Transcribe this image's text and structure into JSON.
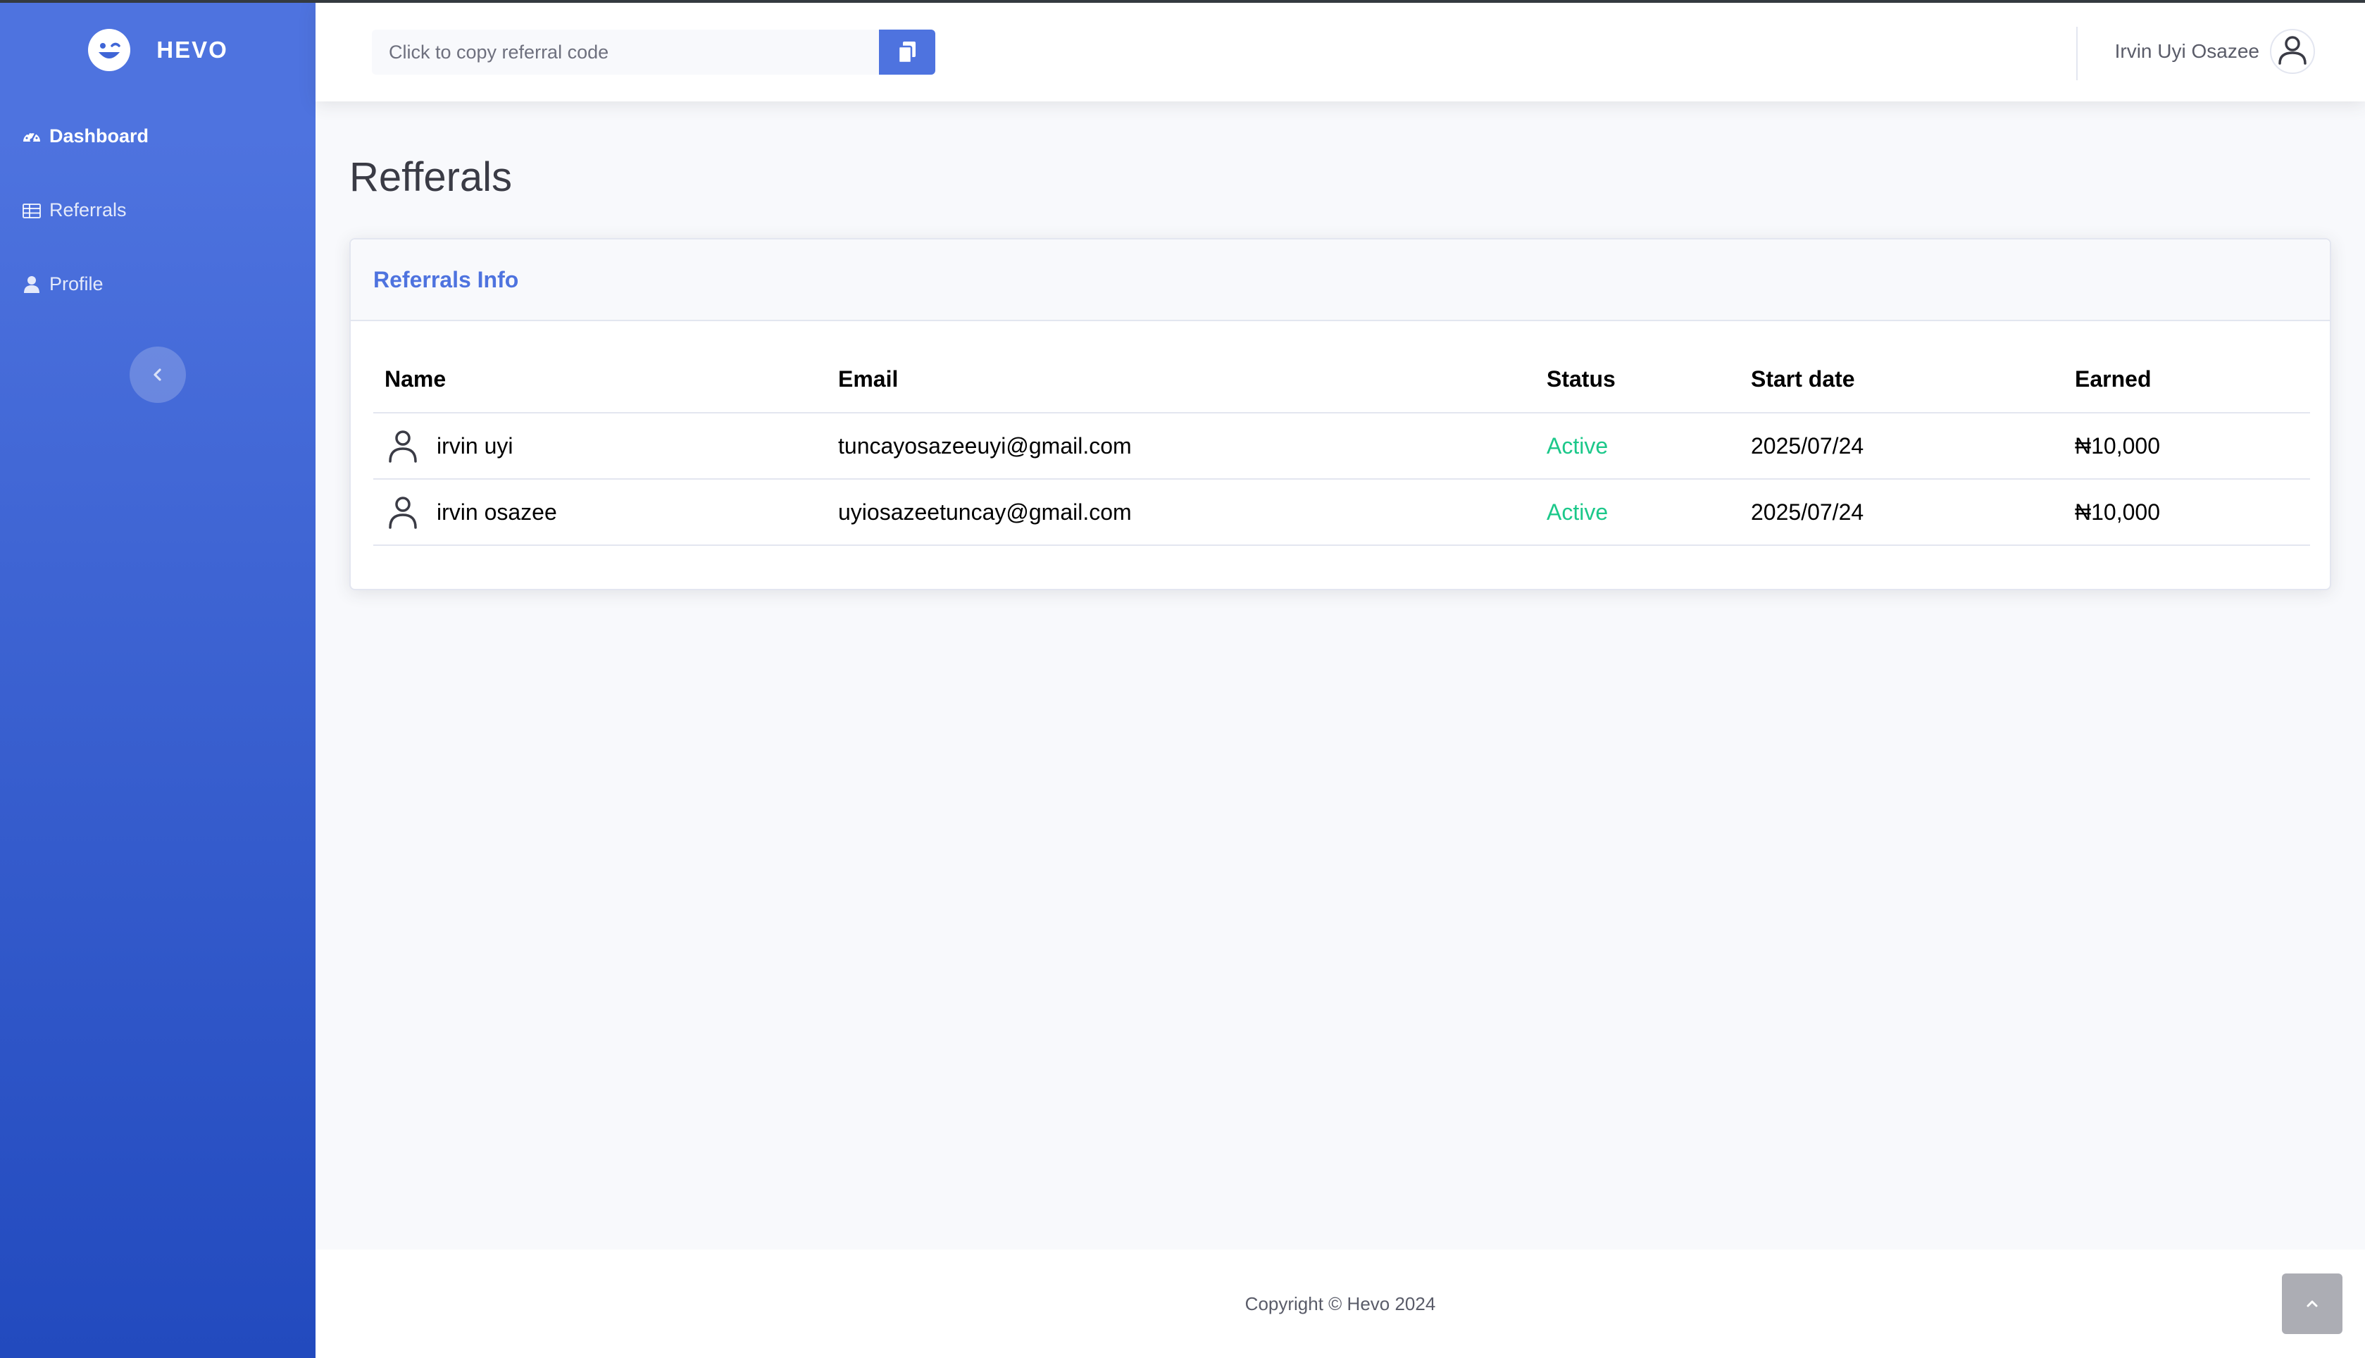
{
  "brand": {
    "name": "HEVO",
    "icon": "laugh-wink-icon"
  },
  "sidebar": {
    "items": [
      {
        "label": "Dashboard",
        "icon": "tachometer-icon",
        "active": true
      },
      {
        "label": "Referrals",
        "icon": "table-icon",
        "active": false
      },
      {
        "label": "Profile",
        "icon": "user-icon",
        "active": false
      }
    ],
    "toggle_icon": "chevron-left-icon"
  },
  "topbar": {
    "referral_placeholder": "Click to copy referral code",
    "copy_icon": "copy-icon",
    "user_name": "Irvin Uyi Osazee",
    "user_icon": "user-avatar-icon"
  },
  "page": {
    "title": "Refferals"
  },
  "card": {
    "title": "Referrals Info",
    "columns": [
      "Name",
      "Email",
      "Status",
      "Start date",
      "Earned"
    ],
    "rows": [
      {
        "name": "irvin uyi",
        "email": "tuncayosazeeuyi@gmail.com",
        "status": "Active",
        "start_date": "2025/07/24",
        "earned": "₦10,000"
      },
      {
        "name": "irvin osazee",
        "email": "uyiosazeetuncay@gmail.com",
        "status": "Active",
        "start_date": "2025/07/24",
        "earned": "₦10,000"
      }
    ]
  },
  "footer": {
    "copyright": "Copyright © Hevo 2024",
    "scroll_icon": "chevron-up-icon"
  },
  "colors": {
    "primary": "#4e73df",
    "primary_dark": "#224abe",
    "success": "#1cc88a",
    "text": "#5a5c69"
  }
}
